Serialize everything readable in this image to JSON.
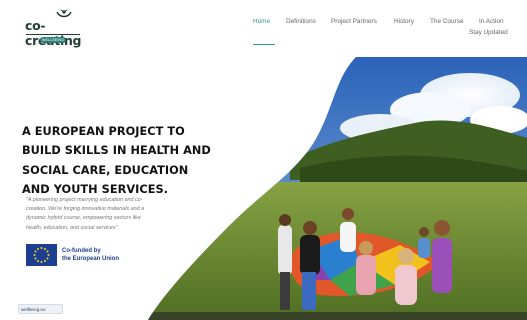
{
  "logo": {
    "name": "co-creating",
    "badge": "WELLBEING"
  },
  "nav": {
    "items": [
      {
        "label": "Home",
        "active": true
      },
      {
        "label": "Definitions"
      },
      {
        "label": "Project Partners"
      },
      {
        "label": "History"
      },
      {
        "label": "The Course"
      },
      {
        "label": "In Action"
      },
      {
        "label": "Stay Updated"
      }
    ]
  },
  "hero": {
    "headline_lines": [
      "A EUROPEAN PROJECT TO",
      "BUILD SKILLS IN HEALTH AND",
      "SOCIAL CARE, EDUCATION",
      "AND YOUTH SERVICES."
    ],
    "subtext_lines": [
      "\"A pioneering project marrying education and co-",
      "creation. We're forging innovative materials and a",
      "dynamic hybrid course, empowering sectors like",
      "health, education, and social services\""
    ],
    "eu_text_lines": [
      "Co-funded by",
      "the European Union"
    ]
  },
  "status_url": "wellbeing.eu",
  "colors": {
    "accent": "#2e9b8d",
    "brand": "#1f3d33",
    "eu_blue": "#1d3f8f",
    "eu_yellow": "#f4d52b"
  }
}
